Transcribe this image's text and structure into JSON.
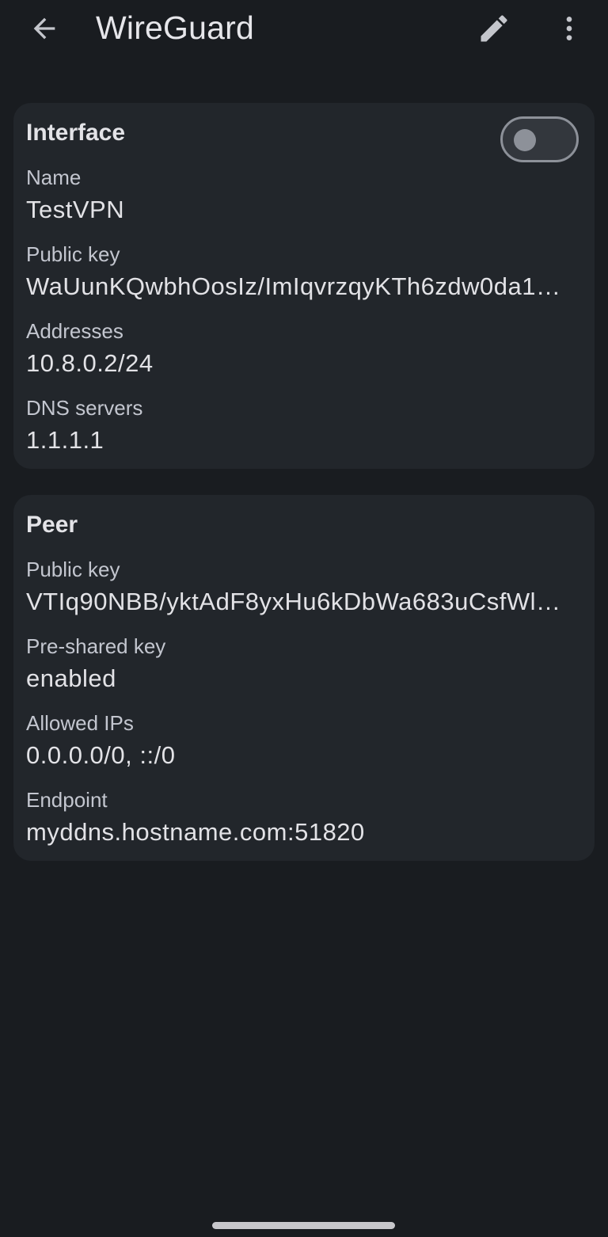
{
  "app_bar": {
    "title": "WireGuard",
    "back_icon": "arrow-back-icon",
    "edit_icon": "pencil-icon",
    "more_icon": "more-vert-icon"
  },
  "interface": {
    "title": "Interface",
    "toggle_on": false,
    "fields": [
      {
        "label": "Name",
        "value": "TestVPN"
      },
      {
        "label": "Public key",
        "value": "WaUunKQwbhOosIz/ImIqvrzqyKTh6zdw0da1…"
      },
      {
        "label": "Addresses",
        "value": "10.8.0.2/24"
      },
      {
        "label": "DNS servers",
        "value": "1.1.1.1"
      }
    ]
  },
  "peer": {
    "title": "Peer",
    "fields": [
      {
        "label": "Public key",
        "value": "VTIq90NBB/yktAdF8yxHu6kDbWa683uCsfWl…"
      },
      {
        "label": "Pre-shared key",
        "value": "enabled"
      },
      {
        "label": "Allowed IPs",
        "value": "0.0.0.0/0, ::/0"
      },
      {
        "label": "Endpoint",
        "value": "myddns.hostname.com:51820"
      }
    ]
  },
  "colors": {
    "background": "#191c20",
    "card": "#22262b",
    "label": "#c3c6cf",
    "value": "#e2e2e6",
    "toggle_outline": "#8d9199"
  }
}
